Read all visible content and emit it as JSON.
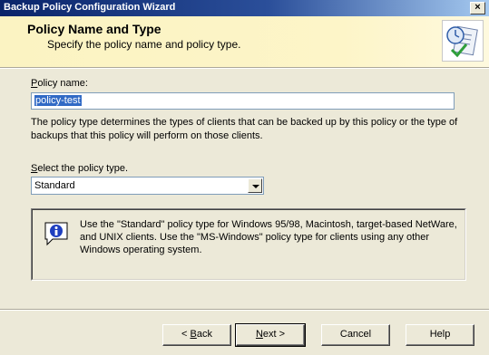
{
  "window": {
    "title": "Backup Policy Configuration Wizard",
    "close_glyph": "×"
  },
  "header": {
    "title": "Policy Name and Type",
    "subtitle": "Specify the policy name and policy type."
  },
  "policy_name": {
    "label_accesskey": "P",
    "label_rest": "olicy name:",
    "value": "policy-test"
  },
  "description": "The policy type determines the types of clients that can be backed up by this policy or the type of backups that this policy will perform on those clients.",
  "policy_type": {
    "label_accesskey": "S",
    "label_rest": "elect the policy type.",
    "selected": "Standard"
  },
  "info": {
    "icon": "info-icon",
    "text": "Use the \"Standard\" policy type for Windows 95/98, Macintosh, target-based NetWare, and UNIX clients.  Use the \"MS-Windows\" policy type for clients using any other Windows operating system."
  },
  "buttons": {
    "back_prefix": "< ",
    "back_accesskey": "B",
    "back_rest": "ack",
    "next_accesskey": "N",
    "next_rest": "ext >",
    "cancel": "Cancel",
    "help": "Help"
  }
}
